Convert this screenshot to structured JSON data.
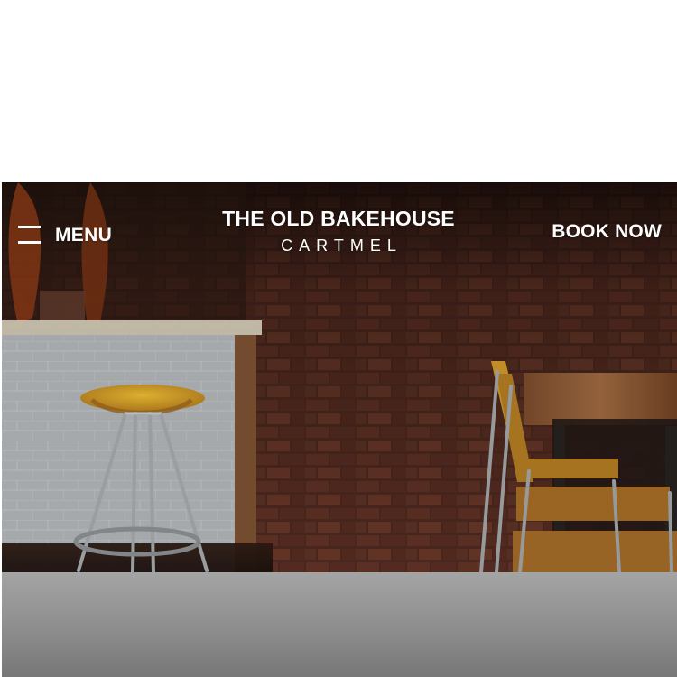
{
  "nav": {
    "menu_label": "MENU",
    "menu_icon": "hamburger-icon",
    "book_now_label": "BOOK NOW"
  },
  "brand": {
    "title": "THE OLD BAKEHOUSE",
    "subtitle": "CARTMEL"
  },
  "hero": {
    "scene": "bakehouse-interior",
    "colors": {
      "brick": "#6b3a2b",
      "stool_seat": "#d6a42a",
      "tabletop": "#8a5a32",
      "counter_tile": "#b8bdc0"
    }
  },
  "colors": {
    "page_background": "#ffffff",
    "nav_text": "#ffffff",
    "bottom_panel": "#999999"
  }
}
